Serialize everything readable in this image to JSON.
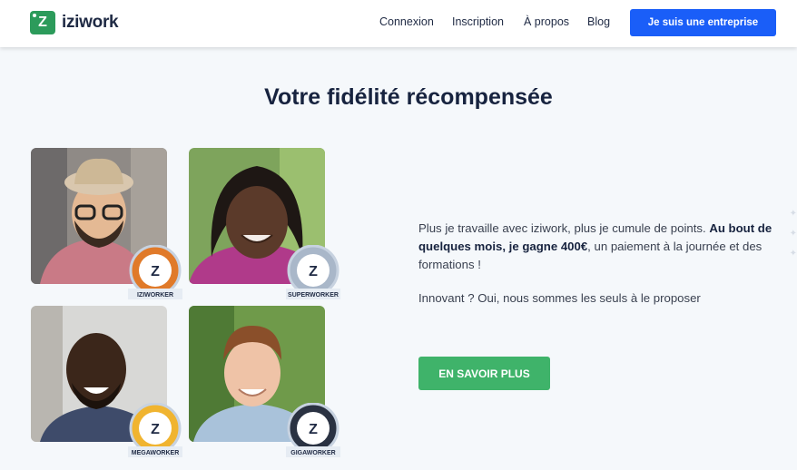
{
  "header": {
    "logo_text": "iziwork",
    "nav": [
      "Connexion",
      "Inscription",
      "À propos",
      "Blog"
    ],
    "cta": "Je suis une entreprise"
  },
  "section": {
    "title": "Votre fidélité récompensée",
    "paragraph_part1": "Plus je travaille avec iziwork, plus je cumule de points. ",
    "paragraph_bold": "Au bout de quelques mois, je gagne 400€",
    "paragraph_part2": ", un paiement à la journée et des formations !",
    "paragraph2": "Innovant ? Oui, nous sommes les seuls à le proposer",
    "button": "EN SAVOIR PLUS"
  },
  "badges": [
    "IZIWORKER",
    "SUPERWORKER",
    "MEGAWORKER",
    "GIGAWORKER"
  ],
  "colors": {
    "brand_green": "#2c9b5b",
    "cta_blue": "#1a5ef8",
    "button_green": "#3fb36a",
    "badge_orange": "#e07a2a",
    "badge_silver": "#a9b7c9",
    "badge_gold": "#f0b430",
    "badge_dark": "#2a3242"
  }
}
